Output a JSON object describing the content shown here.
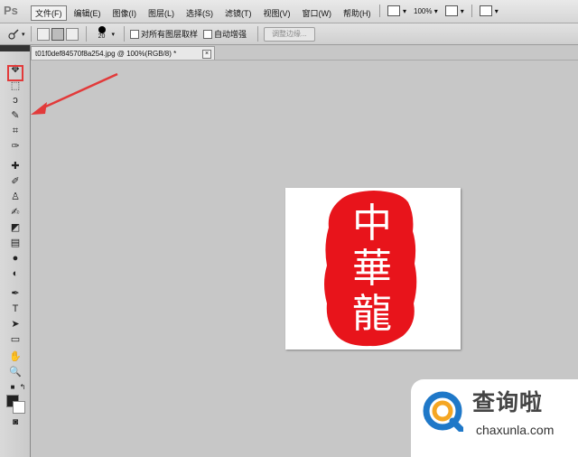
{
  "app": {
    "logo": "Ps"
  },
  "menu": [
    "文件(F)",
    "编辑(E)",
    "图像(I)",
    "图层(L)",
    "选择(S)",
    "滤镜(T)",
    "视图(V)",
    "窗口(W)",
    "帮助(H)"
  ],
  "menu_right": {
    "zoom": "100%"
  },
  "options": {
    "brush_size": "20",
    "sample_all_layers": "对所有图层取样",
    "auto_enhance": "自动增强",
    "refine_edge": "调整边缘..."
  },
  "document": {
    "tab_title": "t01f0def84570f8a254.jpg @ 100%(RGB/8) *",
    "close": "×"
  },
  "tools": [
    {
      "name": "move-tool",
      "glyph": "✥"
    },
    {
      "name": "marquee-tool",
      "glyph": "⬚"
    },
    {
      "name": "lasso-tool",
      "glyph": "ↄ"
    },
    {
      "name": "quick-selection-tool",
      "glyph": "✎"
    },
    {
      "name": "crop-tool",
      "glyph": "⌗"
    },
    {
      "name": "eyedropper-tool",
      "glyph": "✑"
    },
    {
      "name": "healing-brush-tool",
      "glyph": "✚"
    },
    {
      "name": "brush-tool",
      "glyph": "✐"
    },
    {
      "name": "clone-stamp-tool",
      "glyph": "♙"
    },
    {
      "name": "history-brush-tool",
      "glyph": "✍"
    },
    {
      "name": "eraser-tool",
      "glyph": "◩"
    },
    {
      "name": "gradient-tool",
      "glyph": "▤"
    },
    {
      "name": "blur-tool",
      "glyph": "●"
    },
    {
      "name": "dodge-tool",
      "glyph": "◐"
    },
    {
      "name": "pen-tool",
      "glyph": "✒"
    },
    {
      "name": "type-tool",
      "glyph": "T"
    },
    {
      "name": "path-selection-tool",
      "glyph": "➤"
    },
    {
      "name": "shape-tool",
      "glyph": "▭"
    },
    {
      "name": "hand-tool",
      "glyph": "✋"
    },
    {
      "name": "zoom-tool",
      "glyph": "🔍"
    }
  ],
  "seal": {
    "chars": [
      "中",
      "華",
      "龍"
    ],
    "color": "#e8141b"
  },
  "watermark": {
    "title": "查询啦",
    "url": "chaxunla.com"
  },
  "colors": {
    "accent_red": "#e23a3a",
    "watermark_orange": "#f5a623",
    "watermark_blue": "#1f78c8"
  }
}
